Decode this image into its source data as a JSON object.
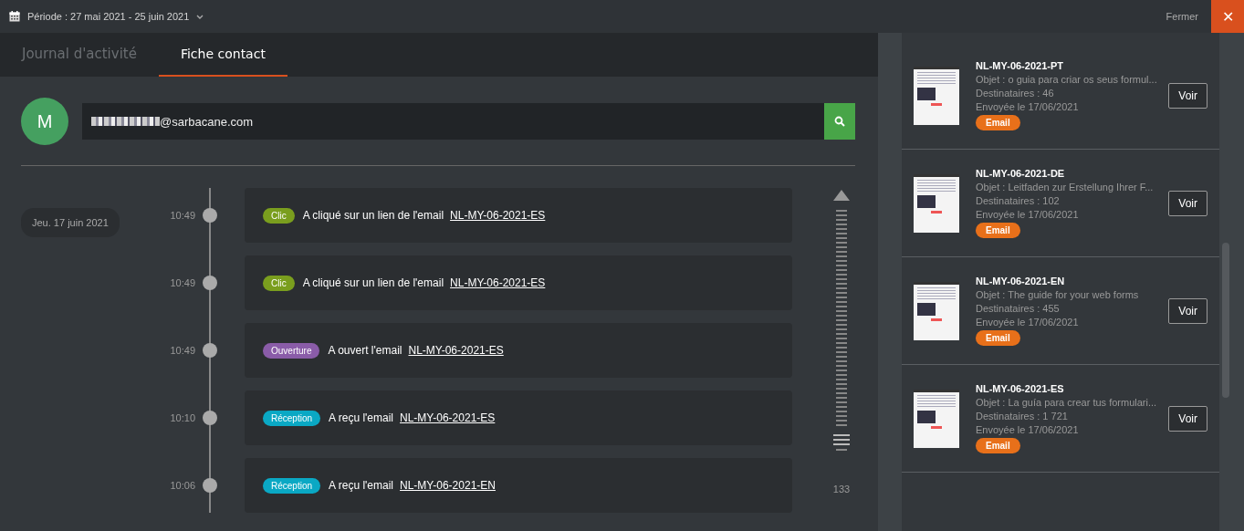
{
  "top_bar": {
    "period": "Période : 27 mai 2021 - 25 juin 2021",
    "close_label": "Fermer",
    "close_icon": "✕"
  },
  "tabs": [
    {
      "label": "Journal d'activité",
      "selected": false
    },
    {
      "label": "Fiche contact",
      "selected": true
    }
  ],
  "contact": {
    "initial": "M",
    "email_visible": "@sarbacane.com"
  },
  "timeline": {
    "date": "Jeu. 17 juin 2021",
    "count": "133",
    "events": [
      {
        "time": "10:49",
        "kind": "clic",
        "tag": "Clic",
        "text": "A cliqué sur un lien de l'email",
        "link": "NL-MY-06-2021-ES"
      },
      {
        "time": "10:49",
        "kind": "clic",
        "tag": "Clic",
        "text": "A cliqué sur un lien de l'email",
        "link": "NL-MY-06-2021-ES"
      },
      {
        "time": "10:49",
        "kind": "ouverture",
        "tag": "Ouverture",
        "text": "A ouvert l'email",
        "link": "NL-MY-06-2021-ES"
      },
      {
        "time": "10:10",
        "kind": "reception",
        "tag": "Réception",
        "text": "A reçu l'email",
        "link": "NL-MY-06-2021-ES"
      },
      {
        "time": "10:06",
        "kind": "reception",
        "tag": "Réception",
        "text": "A reçu l'email",
        "link": "NL-MY-06-2021-EN"
      }
    ]
  },
  "campaigns": [
    {
      "name": "NL-MY-06-2021-PT",
      "subject": "Objet : o guia para criar os seus formul...",
      "recipients": "Destinataires : 46",
      "sent": "Envoyée le 17/06/2021",
      "badge": "Email",
      "button": "Voir"
    },
    {
      "name": "NL-MY-06-2021-DE",
      "subject": "Objet : Leitfaden zur Erstellung Ihrer F...",
      "recipients": "Destinataires : 102",
      "sent": "Envoyée le 17/06/2021",
      "badge": "Email",
      "button": "Voir"
    },
    {
      "name": "NL-MY-06-2021-EN",
      "subject": "Objet : The guide for your web forms",
      "recipients": "Destinataires : 455",
      "sent": "Envoyée le 17/06/2021",
      "badge": "Email",
      "button": "Voir"
    },
    {
      "name": "NL-MY-06-2021-ES",
      "subject": "Objet : La guía para crear tus formulari...",
      "recipients": "Destinataires : 1 721",
      "sent": "Envoyée le 17/06/2021",
      "badge": "Email",
      "button": "Voir"
    }
  ]
}
